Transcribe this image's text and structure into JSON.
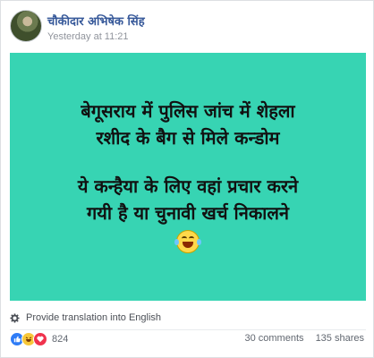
{
  "post": {
    "author": "चौकीदार अभिषेक सिंह",
    "timestamp": "Yesterday at 11:21"
  },
  "image_text": {
    "line1": "बेगूसराय में पुलिस जांच में शेहला",
    "line2": "रशीद के बैग से मिले कन्डोम",
    "line3": "ये कन्हैया के लिए वहां प्रचार करने",
    "line4": "गयी है या चुनावी खर्च निकालने",
    "emoji": "laughing-tears-emoji",
    "background_color": "#37d4b3"
  },
  "translation": {
    "label": "Provide translation into English",
    "icon": "gear-icon"
  },
  "engagement": {
    "reaction_icons": [
      "like-icon",
      "haha-icon",
      "love-icon"
    ],
    "reaction_count": "824",
    "comments": "30 comments",
    "shares": "135 shares"
  }
}
